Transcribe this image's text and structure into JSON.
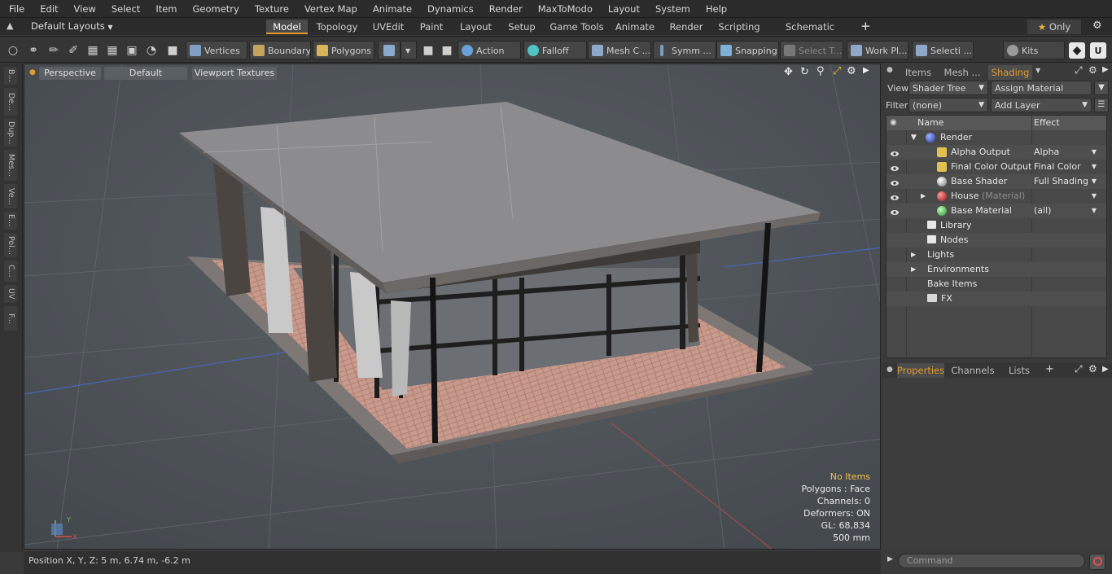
{
  "menu": [
    "File",
    "Edit",
    "View",
    "Select",
    "Item",
    "Geometry",
    "Texture",
    "Vertex Map",
    "Animate",
    "Dynamics",
    "Render",
    "MaxToModo",
    "Layout",
    "System",
    "Help"
  ],
  "layout_selector": "Default Layouts",
  "tabs": [
    "Model",
    "Topology",
    "UVEdit",
    "Paint",
    "Layout",
    "Setup",
    "Game Tools",
    "Animate",
    "Render",
    "Scripting",
    "Schematic Fusion"
  ],
  "only_label": "Only",
  "toolbar": {
    "vertices": "Vertices",
    "boundary": "Boundary",
    "polygons": "Polygons",
    "action": "Action",
    "falloff": "Falloff",
    "mesh": "Mesh C ...",
    "symm": "Symm ...",
    "snapping": "Snapping",
    "select_t": "Select T...",
    "work_pl": "Work Pl...",
    "selecti": "Selecti ...",
    "kits": "Kits"
  },
  "left_tabs": [
    "B...",
    "De...",
    "Dup...",
    "Mes...",
    "Ve...",
    "E...",
    "Pol...",
    "C...",
    "UV",
    "F..."
  ],
  "viewport": {
    "perspective": "Perspective",
    "default": "Default",
    "textures": "Viewport Textures",
    "info": {
      "no_items": "No Items",
      "polygons": "Polygons : Face",
      "channels": "Channels: 0",
      "deformers": "Deformers: ON",
      "gl": "GL: 68,834",
      "scale": "500 mm"
    }
  },
  "status": {
    "position": "Position X, Y, Z:   5 m, 6.74 m, -6.2 m"
  },
  "panel": {
    "tabs": [
      "Items",
      "Mesh ...",
      "Shading"
    ],
    "view_label": "View",
    "view_value": "Shader Tree",
    "assign": "Assign Material",
    "filter_label": "Filter",
    "filter_value": "(none)",
    "add_layer": "Add Layer",
    "col_name": "Name",
    "col_effect": "Effect",
    "rows": [
      {
        "name": "Render",
        "effect": ""
      },
      {
        "name": "Alpha Output",
        "effect": "Alpha"
      },
      {
        "name": "Final Color Output",
        "effect": "Final Color"
      },
      {
        "name": "Base Shader",
        "effect": "Full Shading"
      },
      {
        "name": "House",
        "suffix": "(Material)",
        "effect": ""
      },
      {
        "name": "Base Material",
        "effect": "(all)"
      },
      {
        "name": "Library",
        "effect": ""
      },
      {
        "name": "Nodes",
        "effect": ""
      },
      {
        "name": "Lights",
        "effect": ""
      },
      {
        "name": "Environments",
        "effect": ""
      },
      {
        "name": "Bake Items",
        "effect": ""
      },
      {
        "name": "FX",
        "effect": ""
      }
    ],
    "bottom_tabs": [
      "Properties",
      "Channels",
      "Lists"
    ],
    "command_placeholder": "Command"
  },
  "colors": {
    "accent": "#e39a2c",
    "viewport_bg": "#4d5257",
    "info_highlight": "#f5c04a"
  }
}
